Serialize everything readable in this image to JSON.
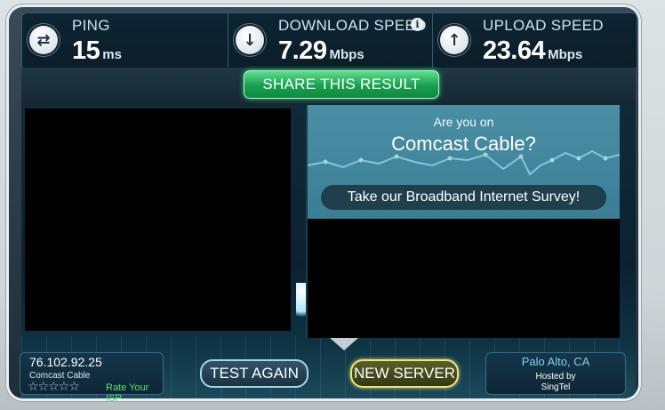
{
  "metrics": {
    "ping": {
      "label": "PING",
      "value": "15",
      "unit": "ms",
      "icon": "swap-arrows-icon"
    },
    "download": {
      "label": "DOWNLOAD SPEED",
      "value": "7.29",
      "unit": "Mbps",
      "icon": "down-arrow-icon"
    },
    "upload": {
      "label": "UPLOAD SPEED",
      "value": "23.64",
      "unit": "Mbps",
      "icon": "up-arrow-icon"
    }
  },
  "share_button": {
    "label": "SHARE THIS RESULT"
  },
  "survey": {
    "question": "Are you on",
    "isp": "Comcast Cable?",
    "cta": "Take our Broadband Internet Survey!"
  },
  "footer": {
    "ip": "76.102.92.25",
    "isp_name": "Comcast Cable",
    "rating_stars": "☆☆☆☆☆",
    "rate_isp": "Rate Your ISP",
    "test_again": "TEST AGAIN",
    "new_server": "NEW SERVER",
    "server_city": "Palo Alto, CA",
    "hosted_by": "Hosted by",
    "host": "SingTel"
  },
  "colors": {
    "accent_green": "#18a04f",
    "rate_green": "#58e06f",
    "server_city_blue": "#7fd3ee"
  }
}
